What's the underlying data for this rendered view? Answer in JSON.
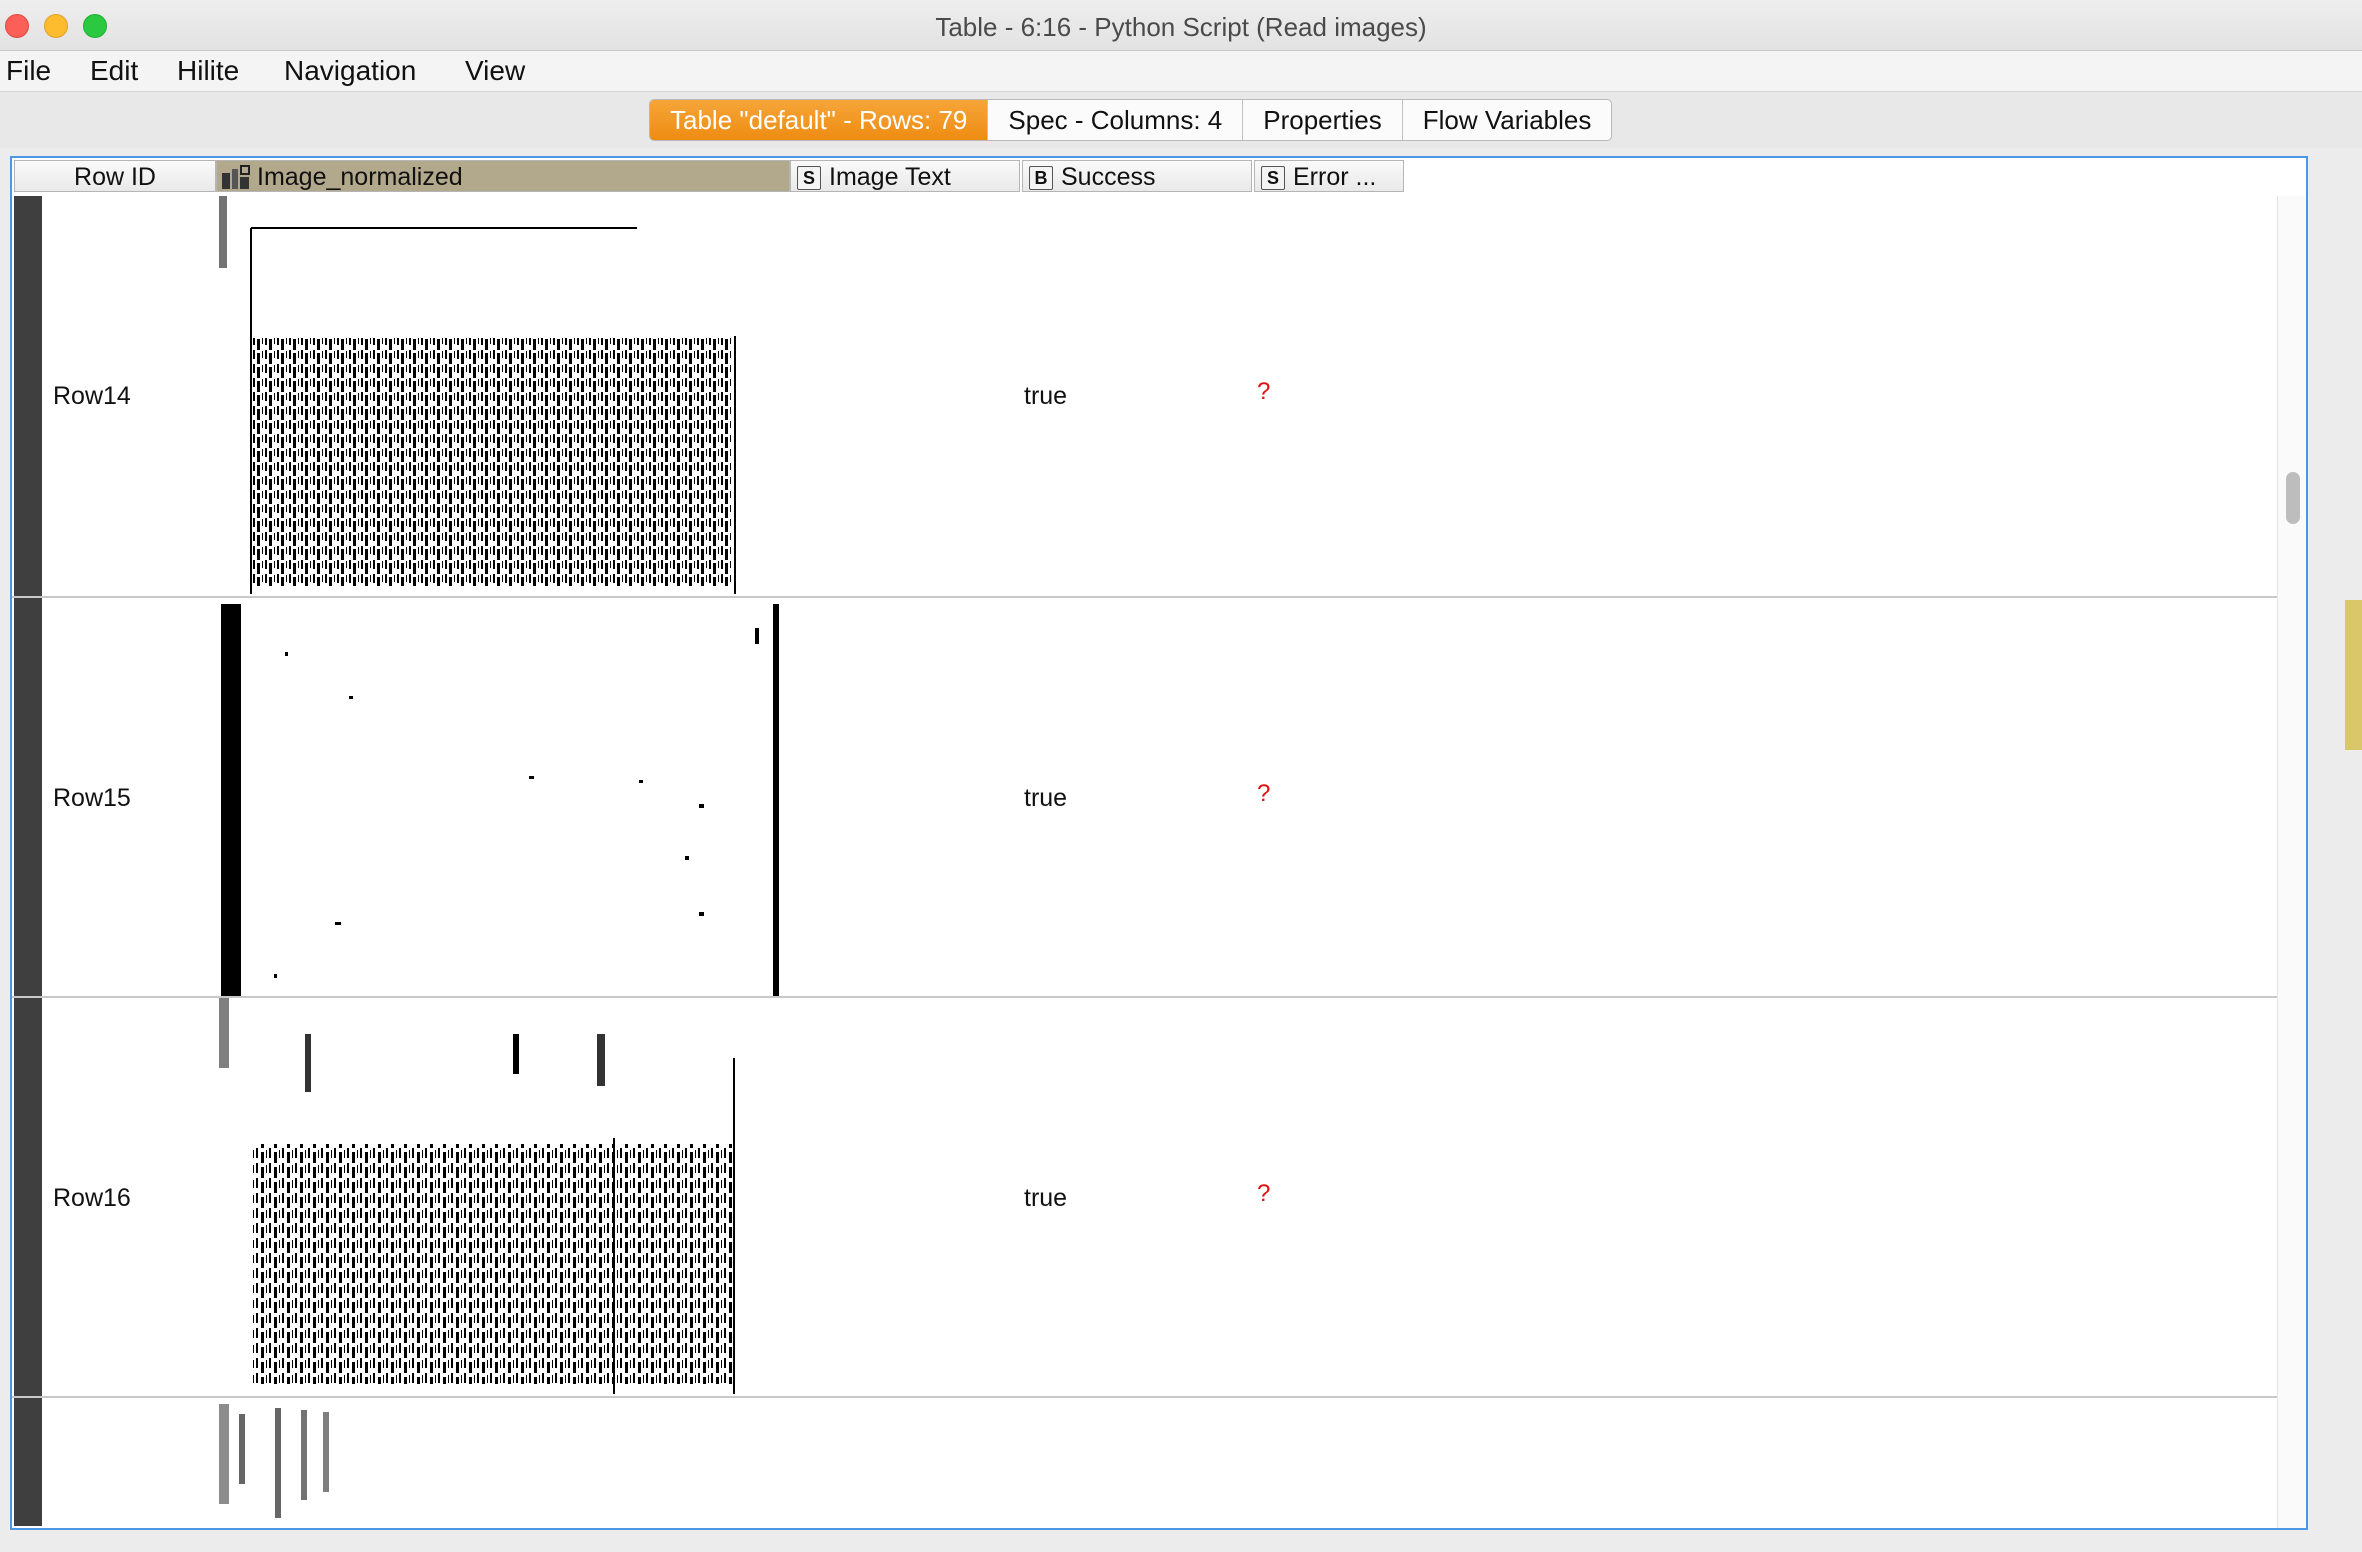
{
  "window": {
    "title": "Table - 6:16 - Python Script (Read images)"
  },
  "menu": {
    "items": [
      "File",
      "Edit",
      "Hilite",
      "Navigation",
      "View"
    ]
  },
  "tabs": [
    {
      "label": "Table \"default\" - Rows: 79",
      "active": true
    },
    {
      "label": "Spec - Columns: 4",
      "active": false
    },
    {
      "label": "Properties",
      "active": false
    },
    {
      "label": "Flow Variables",
      "active": false
    }
  ],
  "columns": [
    {
      "label": "Row ID",
      "type": ""
    },
    {
      "label": "Image_normalized",
      "type": "image-icon"
    },
    {
      "label": "Image Text",
      "type": "S"
    },
    {
      "label": "Success",
      "type": "B"
    },
    {
      "label": "Error ...",
      "type": "S"
    }
  ],
  "rows": [
    {
      "id": "Row14",
      "success": "true",
      "error": "?"
    },
    {
      "id": "Row15",
      "success": "true",
      "error": "?"
    },
    {
      "id": "Row16",
      "success": "true",
      "error": "?"
    }
  ],
  "colors": {
    "active_tab": "#f0961f",
    "sorted_header": "#b2a88c",
    "missing_value": "#e01010",
    "selection_border": "#4c98e6"
  }
}
